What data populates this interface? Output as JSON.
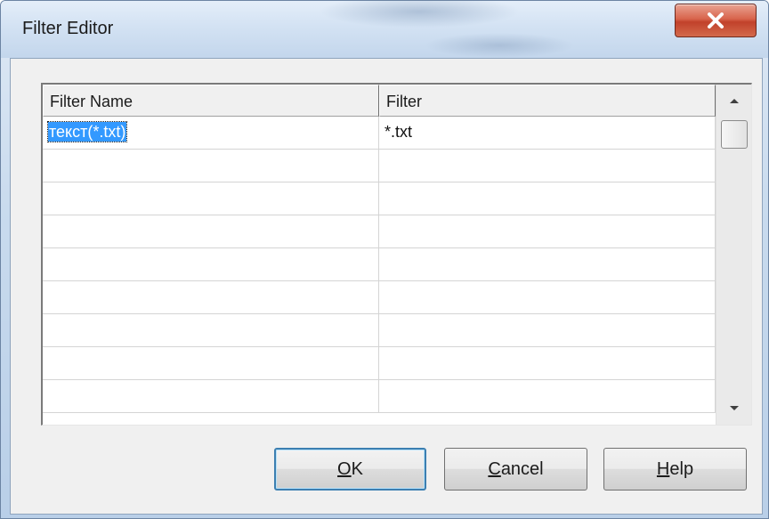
{
  "window": {
    "title": "Filter Editor",
    "close_label": "X"
  },
  "grid": {
    "columns": [
      "Filter Name",
      "Filter"
    ],
    "rows": [
      {
        "name": "текст(*.txt)",
        "filter": "*.txt",
        "selected": true
      },
      {
        "name": "",
        "filter": ""
      },
      {
        "name": "",
        "filter": ""
      },
      {
        "name": "",
        "filter": ""
      },
      {
        "name": "",
        "filter": ""
      },
      {
        "name": "",
        "filter": ""
      },
      {
        "name": "",
        "filter": ""
      },
      {
        "name": "",
        "filter": ""
      },
      {
        "name": "",
        "filter": ""
      }
    ]
  },
  "buttons": {
    "ok": {
      "label": "OK",
      "mnemonic": "O",
      "rest": "K"
    },
    "cancel": {
      "label": "Cancel",
      "mnemonic": "C",
      "rest": "ancel"
    },
    "help": {
      "label": "Help",
      "mnemonic": "H",
      "rest": "elp"
    }
  },
  "colors": {
    "selection": "#3399ff",
    "close_button": "#c9472e",
    "default_button_border": "#3c7fb1"
  },
  "icons": {
    "close": "close-icon",
    "scroll_up": "scroll-up-arrow-icon",
    "scroll_down": "scroll-down-arrow-icon"
  }
}
